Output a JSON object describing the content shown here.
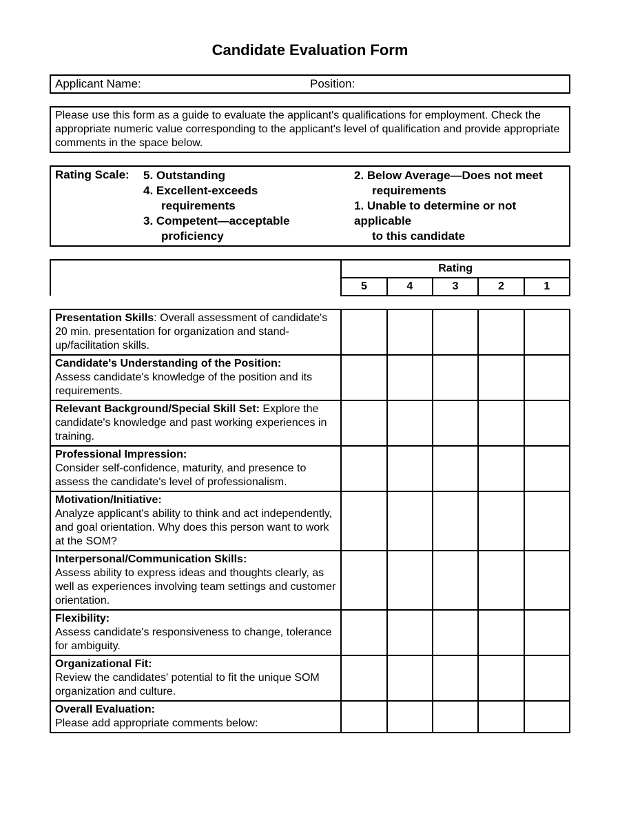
{
  "title": "Candidate Evaluation Form",
  "applicant_label": "Applicant Name:",
  "position_label": "Position:",
  "instructions": "Please use this form as a guide to evaluate the applicant's qualifications for employment.  Check the appropriate numeric value corresponding to the applicant's level of qualification and provide appropriate comments in the space below.",
  "rating_scale_label": "Rating Scale:",
  "scale_left": {
    "a": "5.  Outstanding",
    "b1": "4.  Excellent-exceeds",
    "b2": "requirements",
    "c1": "3.  Competent—acceptable",
    "c2": "proficiency"
  },
  "scale_right": {
    "a1": "2.  Below Average—Does not meet",
    "a2": "requirements",
    "b1": "1.  Unable to determine or not applicable",
    "b2": "to this candidate"
  },
  "rating_header": "Rating",
  "cols": {
    "c5": "5",
    "c4": "4",
    "c3": "3",
    "c2": "2",
    "c1": "1"
  },
  "criteria": [
    {
      "title": "Presentation Skills",
      "text": ": Overall assessment of candidate's 20 min. presentation for organization and stand-up/facilitation skills."
    },
    {
      "title": "Candidate's Understanding of the Position:",
      "text": "Assess candidate's knowledge of the position and its requirements."
    },
    {
      "title": "Relevant Background/Special Skill Set:",
      "text": " Explore the candidate's knowledge and past working experiences in training."
    },
    {
      "title": "Professional Impression:",
      "text": "Consider self-confidence, maturity, and presence to assess the candidate's level of professionalism."
    },
    {
      "title": "Motivation/Initiative:",
      "text": "Analyze applicant's ability to think and act independently, and goal orientation.  Why does this person want to work at the SOM?"
    },
    {
      "title": "Interpersonal/Communication Skills:",
      "text": "Assess ability to express ideas and thoughts clearly, as well as experiences involving team settings and customer orientation."
    },
    {
      "title": "Flexibility:",
      "text": "Assess candidate's responsiveness to change, tolerance for ambiguity."
    },
    {
      "title": "Organizational Fit:",
      "text": "Review the candidates' potential to fit the unique SOM organization and culture."
    },
    {
      "title": "Overall Evaluation:",
      "text": "Please add appropriate comments below:"
    }
  ]
}
